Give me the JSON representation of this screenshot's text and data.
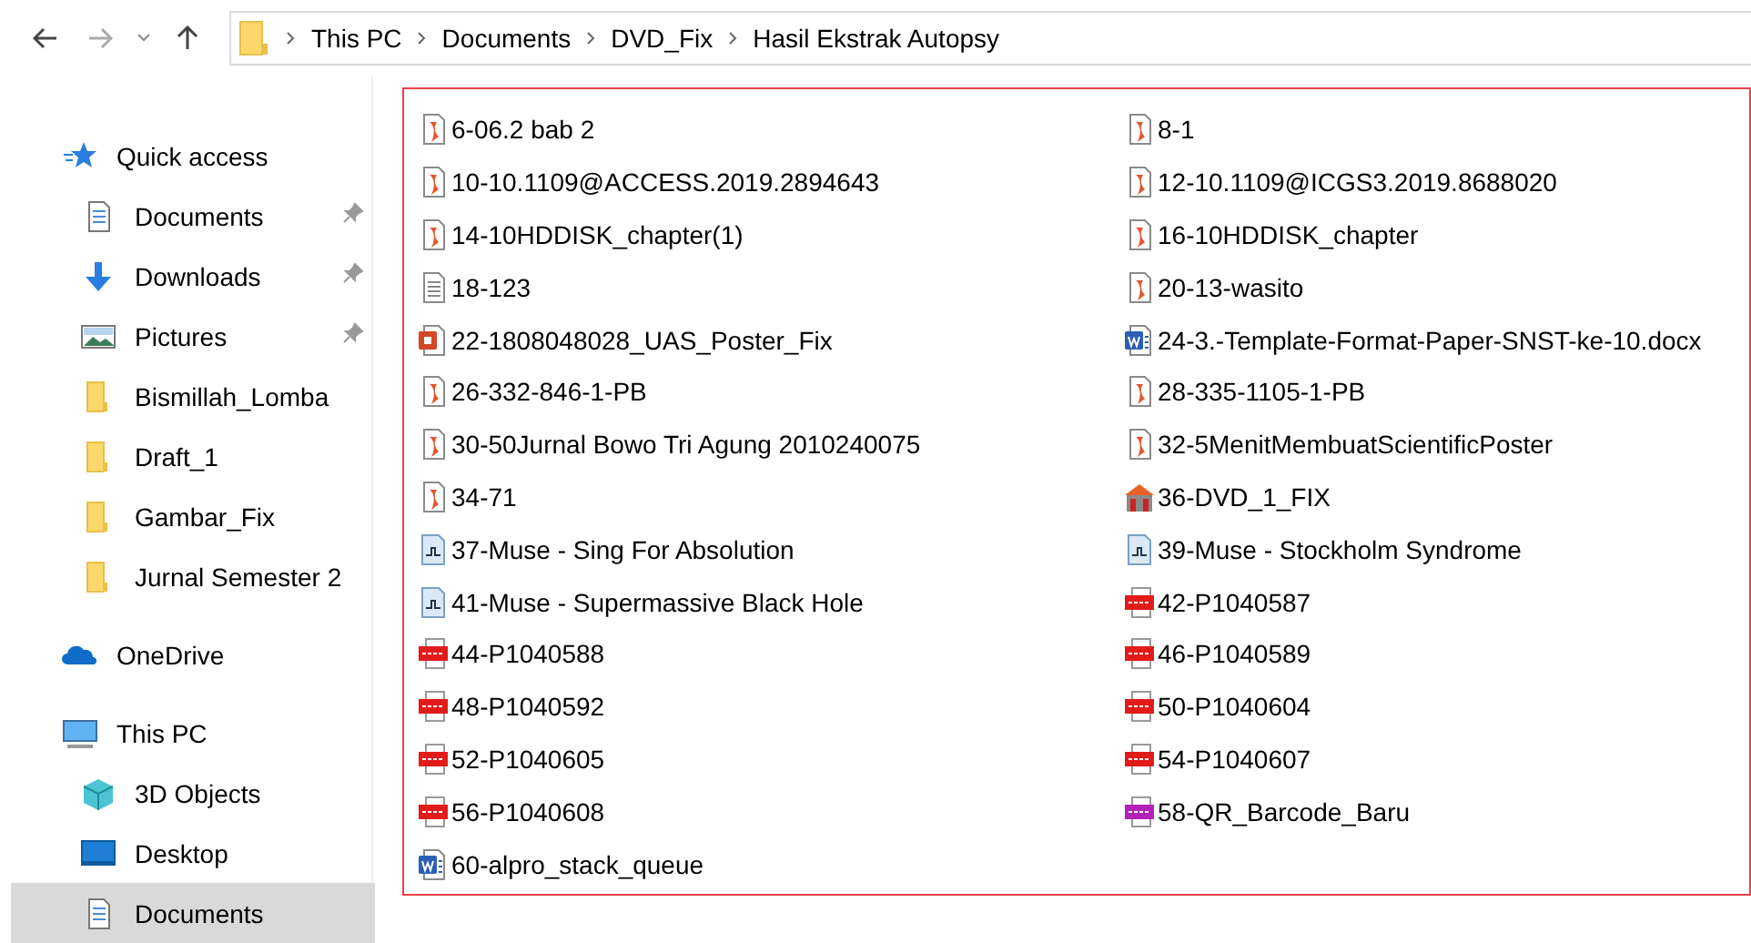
{
  "address_bar": {
    "path": [
      "This PC",
      "Documents",
      "DVD_Fix",
      "Hasil Ekstrak Autopsy"
    ]
  },
  "sidebar": {
    "items": [
      {
        "label": "Quick access",
        "kind": "quick",
        "pinned": false,
        "selected": false
      },
      {
        "label": "Documents",
        "kind": "documents",
        "pinned": true,
        "selected": false
      },
      {
        "label": "Downloads",
        "kind": "downloads",
        "pinned": true,
        "selected": false
      },
      {
        "label": "Pictures",
        "kind": "pictures",
        "pinned": true,
        "selected": false
      },
      {
        "label": "Bismillah_Lomba",
        "kind": "folder",
        "pinned": false,
        "selected": false
      },
      {
        "label": "Draft_1",
        "kind": "folder",
        "pinned": false,
        "selected": false
      },
      {
        "label": "Gambar_Fix",
        "kind": "folder",
        "pinned": false,
        "selected": false
      },
      {
        "label": "Jurnal Semester 2",
        "kind": "folder",
        "pinned": false,
        "selected": false
      },
      {
        "label": "OneDrive",
        "kind": "onedrive",
        "pinned": false,
        "selected": false
      },
      {
        "label": "This PC",
        "kind": "pc",
        "pinned": false,
        "selected": false
      },
      {
        "label": "3D Objects",
        "kind": "objects3d",
        "pinned": false,
        "selected": false
      },
      {
        "label": "Desktop",
        "kind": "desktop",
        "pinned": false,
        "selected": false
      },
      {
        "label": "Documents",
        "kind": "documents",
        "pinned": false,
        "selected": true
      }
    ]
  },
  "files": [
    {
      "name": "6-06.2 bab 2",
      "kind": "pdf"
    },
    {
      "name": "8-1",
      "kind": "pdf"
    },
    {
      "name": "10-10.1109@ACCESS.2019.2894643",
      "kind": "pdf"
    },
    {
      "name": "12-10.1109@ICGS3.2019.8688020",
      "kind": "pdf"
    },
    {
      "name": "14-10HDDISK_chapter(1)",
      "kind": "pdf"
    },
    {
      "name": "16-10HDDISK_chapter",
      "kind": "pdf"
    },
    {
      "name": "18-123",
      "kind": "text"
    },
    {
      "name": "20-13-wasito",
      "kind": "pdf"
    },
    {
      "name": "22-1808048028_UAS_Poster_Fix",
      "kind": "ppt"
    },
    {
      "name": "24-3.-Template-Format-Paper-SNST-ke-10.docx",
      "kind": "word"
    },
    {
      "name": "26-332-846-1-PB",
      "kind": "pdf"
    },
    {
      "name": "28-335-1105-1-PB",
      "kind": "pdf"
    },
    {
      "name": "30-50Jurnal Bowo Tri Agung 2010240075",
      "kind": "pdf"
    },
    {
      "name": "32-5MenitMembuatScientificPoster",
      "kind": "pdf"
    },
    {
      "name": "34-71",
      "kind": "pdf"
    },
    {
      "name": "36-DVD_1_FIX",
      "kind": "setup"
    },
    {
      "name": "37-Muse - Sing For Absolution",
      "kind": "audio"
    },
    {
      "name": "39-Muse - Stockholm Syndrome",
      "kind": "audio"
    },
    {
      "name": "41-Muse - Supermassive Black Hole",
      "kind": "audio"
    },
    {
      "name": "42-P1040587",
      "kind": "jpg"
    },
    {
      "name": "44-P1040588",
      "kind": "jpg"
    },
    {
      "name": "46-P1040589",
      "kind": "jpg"
    },
    {
      "name": "48-P1040592",
      "kind": "jpg"
    },
    {
      "name": "50-P1040604",
      "kind": "jpg"
    },
    {
      "name": "52-P1040605",
      "kind": "jpg"
    },
    {
      "name": "54-P1040607",
      "kind": "jpg"
    },
    {
      "name": "56-P1040608",
      "kind": "jpg"
    },
    {
      "name": "58-QR_Barcode_Baru",
      "kind": "png"
    },
    {
      "name": "60-alpro_stack_queue",
      "kind": "word"
    }
  ]
}
